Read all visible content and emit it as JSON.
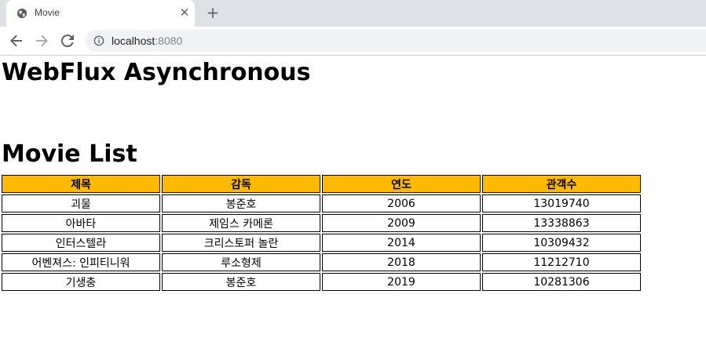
{
  "browser": {
    "tab_title": "Movie",
    "tab_close": "✕",
    "new_tab": "+",
    "url_host": "localhost",
    "url_port": ":8080"
  },
  "page": {
    "heading": "WebFlux Asynchronous",
    "subheading": "Movie List"
  },
  "table": {
    "header_color": "#ffb900",
    "columns": [
      "제목",
      "감독",
      "연도",
      "관객수"
    ],
    "rows": [
      [
        "괴물",
        "봉준호",
        "2006",
        "13019740"
      ],
      [
        "아바타",
        "제임스 카메론",
        "2009",
        "13338863"
      ],
      [
        "인터스텔라",
        "크리스토퍼 놀란",
        "2014",
        "10309432"
      ],
      [
        "어벤져스: 인피티니워",
        "루소형제",
        "2018",
        "11212710"
      ],
      [
        "기생충",
        "봉준호",
        "2019",
        "10281306"
      ]
    ]
  },
  "icons": {
    "favicon": "globe-icon",
    "back": "back-arrow-icon",
    "forward": "forward-arrow-icon",
    "reload": "reload-icon",
    "info": "info-icon"
  }
}
